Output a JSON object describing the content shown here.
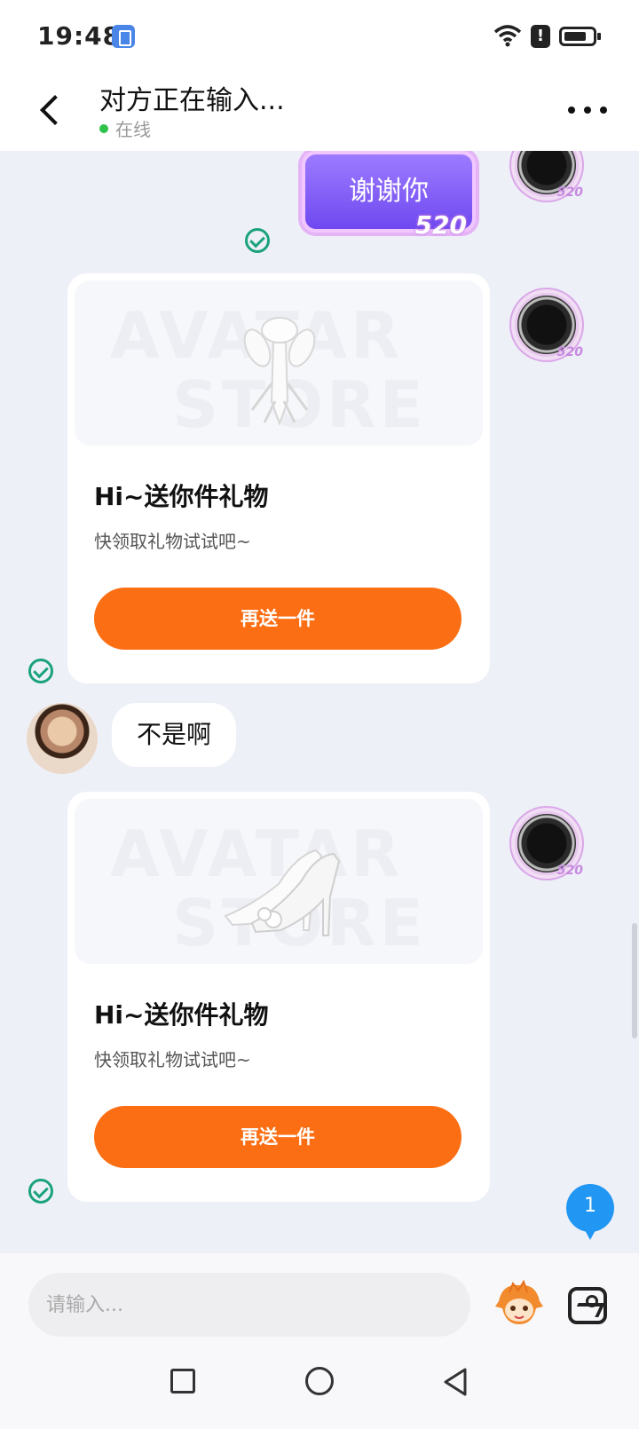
{
  "status_bar": {
    "time": "19:48",
    "icons": [
      "app-notification-icon",
      "wifi-icon",
      "alert-icon",
      "battery-icon"
    ],
    "alert_symbol": "!"
  },
  "header": {
    "title": "对方正在输入...",
    "status": "在线",
    "back_icon": "chevron-left-icon",
    "more_icon": "more-dots-icon"
  },
  "messages": [
    {
      "type": "sticker",
      "from": "me",
      "text": "谢谢你",
      "badge": "520"
    },
    {
      "type": "gift_card",
      "from": "me",
      "watermark": [
        "AVATAR",
        "STORE"
      ],
      "item": "white-bunny-ears-icon",
      "title": "Hi~送你件礼物",
      "subtitle": "快领取礼物试试吧~",
      "button": "再送一件"
    },
    {
      "type": "text",
      "from": "other",
      "text": "不是啊"
    },
    {
      "type": "gift_card",
      "from": "me",
      "watermark": [
        "AVATAR",
        "STORE"
      ],
      "item": "white-high-heels-icon",
      "title": "Hi~送你件礼物",
      "subtitle": "快领取礼物试试吧~",
      "button": "再送一件"
    }
  ],
  "avatar_frame_label": "520",
  "unread_count": "1",
  "input": {
    "placeholder": "请输入..."
  },
  "colors": {
    "accent_orange": "#fb6e13",
    "online_green": "#2fc24a",
    "check_green": "#1aa37a",
    "unread_blue": "#2196f3",
    "sticker_purple": "#7b5cf5"
  }
}
